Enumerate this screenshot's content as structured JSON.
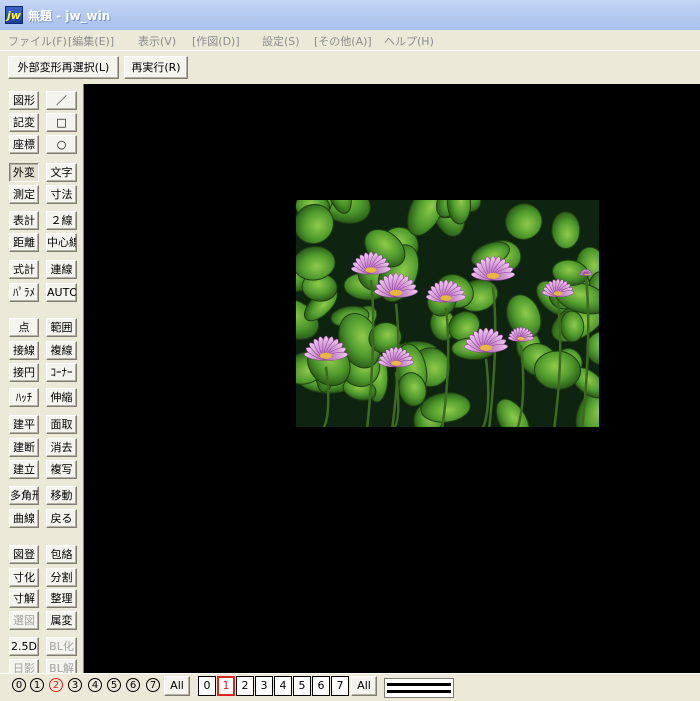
{
  "window": {
    "app_icon": "jw",
    "title": "無題 - jw_win"
  },
  "menu": [
    {
      "label": "ファイル(F)"
    },
    {
      "label": "[編集(E)]"
    },
    {
      "label": "表示(V)"
    },
    {
      "label": "[作図(D)]"
    },
    {
      "label": "設定(S)"
    },
    {
      "label": "[その他(A)]"
    },
    {
      "label": "ヘルプ(H)"
    }
  ],
  "toolbar": {
    "reselect_label": "外部変形再選択(L)",
    "rerun_label": "再実行(R)"
  },
  "tools_left": [
    "図形",
    "記変",
    "座標",
    "外変",
    "測定",
    "表計",
    "距離",
    "式計",
    "ﾊﾟﾗﾒ",
    "点",
    "接線",
    "接円",
    "ﾊｯﾁ",
    "建平",
    "建断",
    "建立",
    "多角形",
    "曲線",
    "図登",
    "寸化",
    "寸解",
    "選図",
    "2.5D",
    "日影"
  ],
  "tools_right": [
    "／",
    "□",
    "○",
    "文字",
    "寸法",
    "２線",
    "中心線",
    "連線",
    "AUTO",
    "範囲",
    "複線",
    "ｺｰﾅｰ",
    "伸縮",
    "面取",
    "消去",
    "複写",
    "移動",
    "戻る",
    "包絡",
    "分割",
    "整理",
    "属変",
    "BL化",
    "BL解"
  ],
  "layer_groups": {
    "labels": [
      "0",
      "1",
      "2",
      "3",
      "4",
      "5",
      "6",
      "7"
    ],
    "all_label": "All",
    "active": "2"
  },
  "layers": {
    "labels": [
      "0",
      "1",
      "2",
      "3",
      "4",
      "5",
      "6",
      "7"
    ],
    "all_label": "All",
    "active": "1"
  },
  "canvas": {
    "background": "#000000",
    "image_description_icon": "water-lily-photo"
  }
}
